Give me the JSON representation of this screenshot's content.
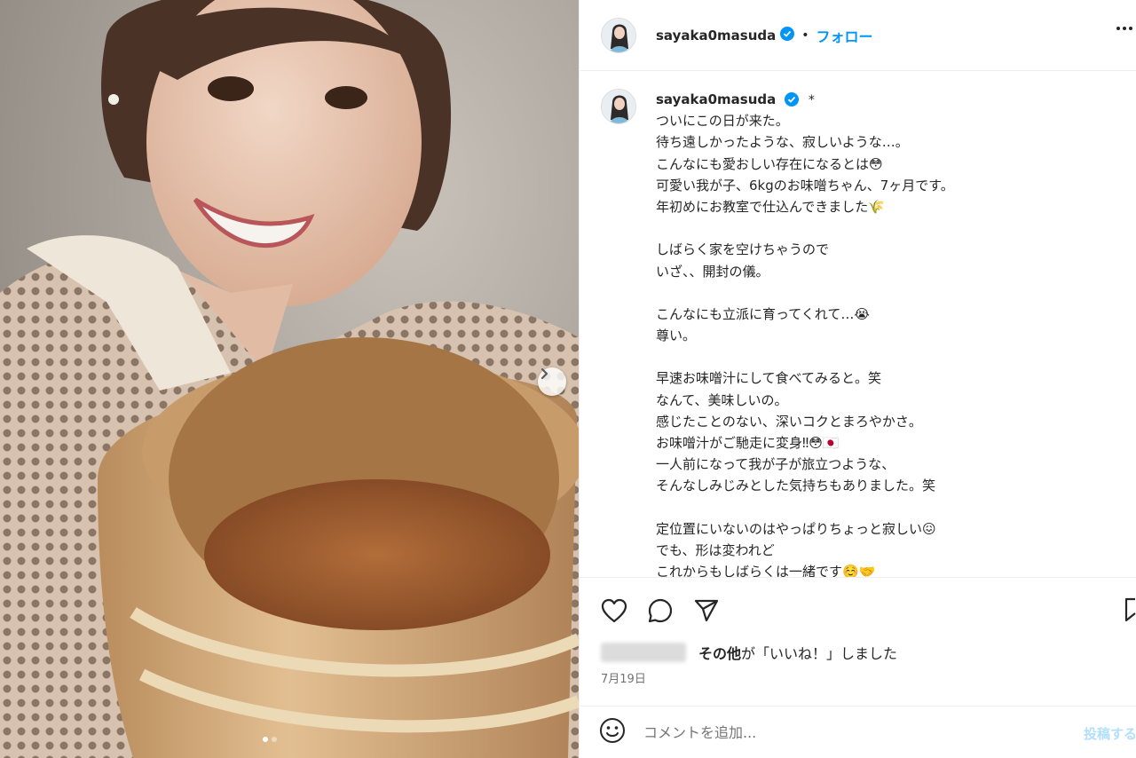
{
  "photo": {
    "alt": "Woman holding a wooden barrel of homemade miso",
    "dots_total": 2,
    "dots_active": 0
  },
  "header": {
    "username": "sayaka0masuda",
    "separator": "•",
    "follow_label": "フォロー"
  },
  "caption": {
    "username": "sayaka0masuda",
    "marker": "*",
    "lines": [
      "ついにこの日が来た。",
      "待ち遠しかったような、寂しいような…。",
      "こんなにも愛おしい存在になるとは😳",
      "可愛い我が子、6kgのお味噌ちゃん、7ヶ月です。",
      "年初めにお教室で仕込んできました🌾",
      "",
      "しばらく家を空けちゃうので",
      "いざ、、開封の儀。",
      "",
      "こんなにも立派に育ってくれて…😭",
      "尊い。",
      "",
      "早速お味噌汁にして食べてみると。笑",
      "なんて、美味しいの。",
      "感じたことのない、深いコクとまろやかさ。",
      "お味噌汁がご馳走に変身‼︎😳🇯🇵",
      "一人前になって我が子が旅立つような、",
      "そんなしみじみとした気持ちもありました。笑",
      "",
      "定位置にいないのはやっぱりちょっと寂しい😖",
      "でも、形は変われど",
      "これからもしばらくは一緒です☺️🤝"
    ]
  },
  "likes": {
    "bold": "その他",
    "rest": "が「いいね！」しました"
  },
  "date": "7月19日",
  "comment": {
    "placeholder": "コメントを追加...",
    "post_label": "投稿する"
  },
  "colors": {
    "accent": "#0095f6",
    "text": "#262626",
    "muted": "#737373"
  }
}
